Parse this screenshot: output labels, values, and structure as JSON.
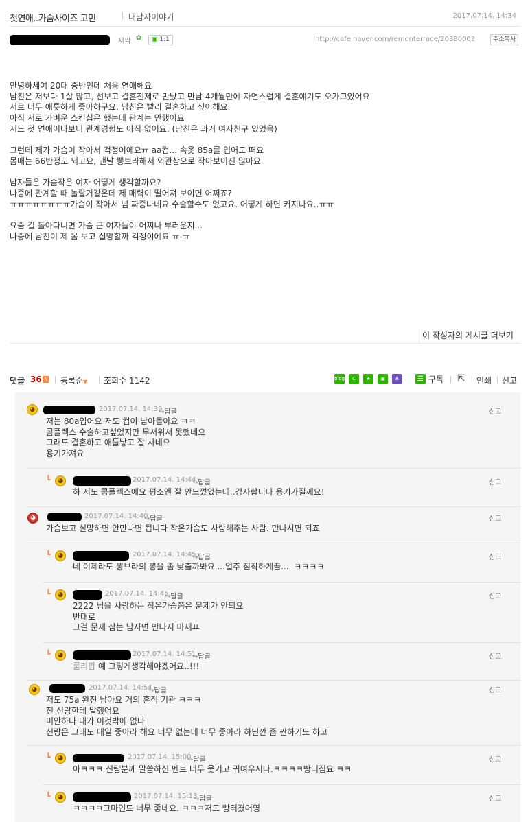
{
  "post": {
    "title": "첫연애..가슴사이즈 고민",
    "board": "내남자이야기",
    "date": "2017.07.14. 14:34",
    "author_rank": "새싹",
    "chat_label": "1:1",
    "url": "http://cafe.naver.com/remonterrace/20880002",
    "copy_label": "주소복사",
    "body": [
      "안녕하세여 20대 중반인데 처음 연애해요",
      "남친은 저보다 1살 많고, 선보고 결혼전제로 만났고 만남 4개월만에 자연스럽게 결혼얘기도 오가고있어요",
      "서로 너무 애틋하게 좋아하구요. 남친은 빨리 결혼하고 싶어해요.",
      "아직 서로 가벼운 스킨십은 했는데 관계는 안했어요",
      "저도 첫 연애이다보니 관계경험도 아직 없어요. (남친은 과거 여자친구 있었음)",
      "",
      "그런데 제가 가슴이 작아서 걱정이에요ㅠ aa컵... 속옷 85a를 입어도 떠요",
      "몸매는 66반정도 되고요, 맨날 뽕브라해서 외관상으로 작아보이진 않아요",
      "",
      "남자들은 가슴작은 여자 어떻게 생각할까요?",
      "나중에 관계할 때 놀랄거같은데 제 매력이 떨어져 보이면 어쩌죠?",
      "ㅠㅠㅠㅠㅠㅠㅠㅠ가슴이 작아서 넘 짜증나네요 수술할수도 없고요. 어떻게 하면 커지나요..ㅠㅠ",
      "",
      "요즘 길 돌아다니면 가슴 큰 여자들이 어찌나 부러운지...",
      "나중에 남친이 제 몸 보고 실망할까 걱정이에요 ㅠ-ㅠ"
    ],
    "more_posts_label": "이 작성자의 게시글 더보기"
  },
  "comment_bar": {
    "label": "댓글",
    "count": "36",
    "new_badge": "N",
    "sort_label": "등록순",
    "view_label": "조회수 1142",
    "subscribe_label": "구독",
    "print_label": "인쇄",
    "report_label": "신고"
  },
  "share_icons": [
    {
      "name": "blog-share-icon",
      "label": "blog",
      "color": "#2db400"
    },
    {
      "name": "cafe-share-icon",
      "label": "C",
      "color": "#2db400"
    },
    {
      "name": "star-share-icon",
      "label": "★",
      "color": "#2db400"
    },
    {
      "name": "memo-share-icon",
      "label": "▣",
      "color": "#2db400"
    },
    {
      "name": "band-share-icon",
      "label": "B",
      "color": "#6b4fbb"
    }
  ],
  "comments": [
    {
      "date": "2017.07.14. 14:39",
      "reply": "답글",
      "report": "신고",
      "text": "저는 80a입어요 저도 컵이 남아돌아요 ㅋㅋ\n콤플렉스 수술하고싶었지만 무서워서 못했네요\n그래도 결혼하고 애들낳고 잘 사네요\n용기가져요"
    },
    {
      "date": "2017.07.14. 14:44",
      "reply": "답글",
      "report": "신고",
      "text": "하 저도 콤플렉스에요 평소엔 잘 안느꼈었는데..감사합니다 용기가질께요!"
    },
    {
      "date": "2017.07.14. 14:40",
      "reply": "답글",
      "report": "신고",
      "text": "가슴보고 실망하면 안만나면 됩니다 작은가슴도 사랑해주는 사람. 만나시면 되죠"
    },
    {
      "date": "2017.07.14. 14:45",
      "reply": "답글",
      "report": "신고",
      "text": "네 이제라도 뽕브라의 뽕을 좀 낮출까봐요....얼추 짐작하게끔.... ㅋㅋㅋㅋ"
    },
    {
      "date": "2017.07.14. 14:45",
      "reply": "답글",
      "report": "신고",
      "text": "2222 님을 사랑하는 작은가슴쯤은 문제가 안되요\n반대로\n그걸 문제 삼는 남자면 만나지 마세ㅛ"
    },
    {
      "date": "2017.07.14. 14:51",
      "reply": "답글",
      "report": "신고",
      "tag": "룰리팝",
      "text": "예 그렇게생각해야겠어요..!!!"
    },
    {
      "date": "2017.07.14. 14:54",
      "reply": "답글",
      "report": "신고",
      "text": "저도 75a 완전 남아요 거의 흔적 기관 ㅋㅋㅋ\n전 신랑한테 말했어요\n미안하다 내가 이것밖에 없다\n신랑은 그래도 매일 좋아라 해요 너무 없는데 너무 좋아라 하닌깐 좀 짠하기도 하고"
    },
    {
      "date": "2017.07.14. 15:00",
      "reply": "답글",
      "report": "신고",
      "text": "아ㅋㅋㅋ 신랑분께 말씀하신 멘트 너무 웃기고 귀여우시다.ㅋㅋㅋㅋ빵터짐요 ㅋㅋ"
    },
    {
      "date": "2017.07.14. 15:13",
      "reply": "답글",
      "report": "신고",
      "text": "ㅋㅋㅋㅋ그마인드 너무 좋네요. ㅋㅋㅋ저도 빵터졌어영"
    }
  ]
}
